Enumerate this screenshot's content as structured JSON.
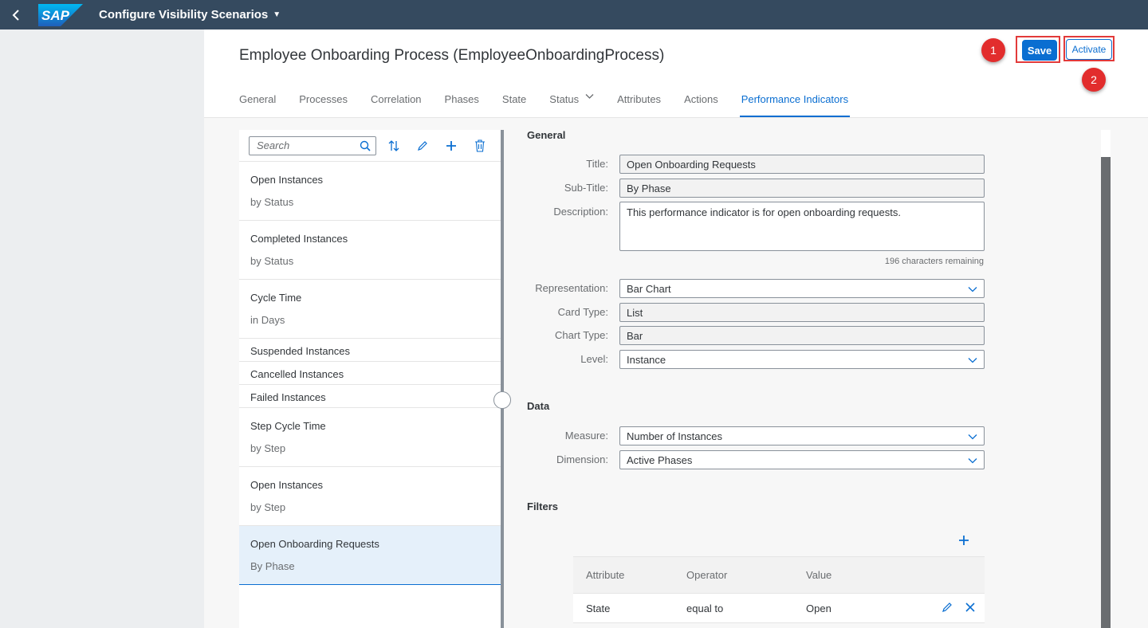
{
  "shell": {
    "title": "Configure Visibility Scenarios",
    "logo": "SAP"
  },
  "header": {
    "object_title": "Employee Onboarding Process (EmployeeOnboardingProcess)",
    "save_label": "Save",
    "activate_label": "Activate",
    "badge1": "1",
    "badge2": "2"
  },
  "tabs": [
    {
      "label": "General"
    },
    {
      "label": "Processes"
    },
    {
      "label": "Correlation"
    },
    {
      "label": "Phases"
    },
    {
      "label": "State"
    },
    {
      "label": "Status"
    },
    {
      "label": "Attributes"
    },
    {
      "label": "Actions"
    },
    {
      "label": "Performance Indicators"
    }
  ],
  "list": {
    "search_placeholder": "Search",
    "items": [
      {
        "title": "Open Instances",
        "subtitle": "by Status"
      },
      {
        "title": "Completed Instances",
        "subtitle": "by Status"
      },
      {
        "title": "Cycle Time",
        "subtitle": "in Days"
      },
      {
        "title": "Suspended Instances"
      },
      {
        "title": "Cancelled Instances"
      },
      {
        "title": "Failed Instances"
      },
      {
        "title": "Step Cycle Time",
        "subtitle": "by Step"
      },
      {
        "title": "Open Instances",
        "subtitle": "by Step"
      },
      {
        "title": "Open Onboarding Requests",
        "subtitle": "By Phase"
      }
    ]
  },
  "form": {
    "general_title": "General",
    "title_label": "Title:",
    "title_value": "Open Onboarding Requests",
    "subtitle_label": "Sub-Title:",
    "subtitle_value": "By Phase",
    "description_label": "Description:",
    "description_value": "This performance indicator is for open onboarding requests.",
    "chars_remaining": "196 characters remaining",
    "representation_label": "Representation:",
    "representation_value": "Bar Chart",
    "card_type_label": "Card Type:",
    "card_type_value": "List",
    "chart_type_label": "Chart Type:",
    "chart_type_value": "Bar",
    "level_label": "Level:",
    "level_value": "Instance",
    "data_title": "Data",
    "measure_label": "Measure:",
    "measure_value": "Number of Instances",
    "dimension_label": "Dimension:",
    "dimension_value": "Active Phases",
    "filters_title": "Filters"
  },
  "filters": {
    "headers": {
      "attribute": "Attribute",
      "operator": "Operator",
      "value": "Value"
    },
    "rows": [
      {
        "attribute": "State",
        "operator": "equal to",
        "value": "Open"
      }
    ]
  },
  "colors": {
    "accent": "#0a6ed1",
    "shell": "#354a5f",
    "badge": "#e22d2d"
  }
}
